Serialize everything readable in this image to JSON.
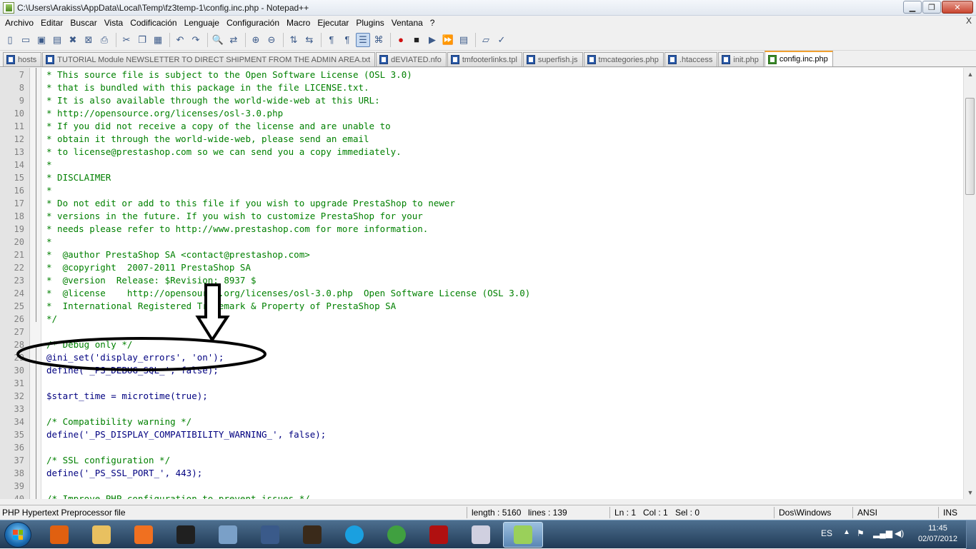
{
  "window": {
    "title": "C:\\Users\\Arakiss\\AppData\\Local\\Temp\\fz3temp-1\\config.inc.php - Notepad++",
    "minimize_glyph": "▁",
    "maximize_glyph": "❐",
    "close_glyph": "✕"
  },
  "menu": {
    "items": [
      "Archivo",
      "Editar",
      "Buscar",
      "Vista",
      "Codificación",
      "Lenguaje",
      "Configuración",
      "Macro",
      "Ejecutar",
      "Plugins",
      "Ventana",
      "?"
    ],
    "close_glyph": "X"
  },
  "toolbar": {
    "icons": [
      "new-file-icon",
      "open-file-icon",
      "save-icon",
      "save-all-icon",
      "close-icon",
      "close-all-icon",
      "print-icon",
      "cut-icon",
      "copy-icon",
      "paste-icon",
      "undo-icon",
      "redo-icon",
      "find-icon",
      "replace-icon",
      "zoom-in-icon",
      "zoom-out-icon",
      "sync-vertical-icon",
      "sync-horizontal-icon",
      "word-wrap-icon",
      "all-characters-icon",
      "indent-guide-icon",
      "user-language-icon",
      "record-macro-icon",
      "stop-record-icon",
      "play-macro-icon",
      "run-macro-multiple-icon",
      "save-macro-icon",
      "folder-icon",
      "spell-check-icon"
    ]
  },
  "tabs": [
    {
      "label": "hosts",
      "active": false
    },
    {
      "label": "TUTORIAL Module NEWSLETTER TO DIRECT SHIPMENT FROM THE ADMIN AREA.txt",
      "active": false
    },
    {
      "label": "dEVIATED.nfo",
      "active": false
    },
    {
      "label": "tmfooterlinks.tpl",
      "active": false
    },
    {
      "label": "superfish.js",
      "active": false
    },
    {
      "label": "tmcategories.php",
      "active": false
    },
    {
      "label": ".htaccess",
      "active": false
    },
    {
      "label": "init.php",
      "active": false
    },
    {
      "label": "config.inc.php",
      "active": true
    }
  ],
  "editor": {
    "lines": [
      {
        "n": "7",
        "text": "* This source file is subject to the Open Software License (OSL 3.0)",
        "kind": "comment"
      },
      {
        "n": "8",
        "text": "* that is bundled with this package in the file LICENSE.txt.",
        "kind": "comment"
      },
      {
        "n": "9",
        "text": "* It is also available through the world-wide-web at this URL:",
        "kind": "comment"
      },
      {
        "n": "10",
        "text": "* http://opensource.org/licenses/osl-3.0.php",
        "kind": "comment"
      },
      {
        "n": "11",
        "text": "* If you did not receive a copy of the license and are unable to",
        "kind": "comment"
      },
      {
        "n": "12",
        "text": "* obtain it through the world-wide-web, please send an email",
        "kind": "comment"
      },
      {
        "n": "13",
        "text": "* to license@prestashop.com so we can send you a copy immediately.",
        "kind": "comment"
      },
      {
        "n": "14",
        "text": "*",
        "kind": "comment"
      },
      {
        "n": "15",
        "text": "* DISCLAIMER",
        "kind": "comment"
      },
      {
        "n": "16",
        "text": "*",
        "kind": "comment"
      },
      {
        "n": "17",
        "text": "* Do not edit or add to this file if you wish to upgrade PrestaShop to newer",
        "kind": "comment"
      },
      {
        "n": "18",
        "text": "* versions in the future. If you wish to customize PrestaShop for your",
        "kind": "comment"
      },
      {
        "n": "19",
        "text": "* needs please refer to http://www.prestashop.com for more information.",
        "kind": "comment"
      },
      {
        "n": "20",
        "text": "*",
        "kind": "comment"
      },
      {
        "n": "21",
        "text": "*  @author PrestaShop SA <contact@prestashop.com>",
        "kind": "comment"
      },
      {
        "n": "22",
        "text": "*  @copyright  2007-2011 PrestaShop SA",
        "kind": "comment"
      },
      {
        "n": "23",
        "text": "*  @version  Release: $Revision: 8937 $",
        "kind": "comment"
      },
      {
        "n": "24",
        "text": "*  @license    http://opensource.org/licenses/osl-3.0.php  Open Software License (OSL 3.0)",
        "kind": "comment"
      },
      {
        "n": "25",
        "text": "*  International Registered Trademark & Property of PrestaShop SA",
        "kind": "comment"
      },
      {
        "n": "26",
        "text": "*/",
        "kind": "comment"
      },
      {
        "n": "27",
        "text": "",
        "kind": "blank"
      },
      {
        "n": "28",
        "text": "/* Debug only */",
        "kind": "comment"
      },
      {
        "n": "29",
        "text": "@ini_set('display_errors', 'on');",
        "kind": "php"
      },
      {
        "n": "30",
        "text": "define('_PS_DEBUG_SQL_', false);",
        "kind": "php"
      },
      {
        "n": "31",
        "text": "",
        "kind": "blank"
      },
      {
        "n": "32",
        "text": "$start_time = microtime(true);",
        "kind": "php"
      },
      {
        "n": "33",
        "text": "",
        "kind": "blank"
      },
      {
        "n": "34",
        "text": "/* Compatibility warning */",
        "kind": "comment"
      },
      {
        "n": "35",
        "text": "define('_PS_DISPLAY_COMPATIBILITY_WARNING_', false);",
        "kind": "php"
      },
      {
        "n": "36",
        "text": "",
        "kind": "blank"
      },
      {
        "n": "37",
        "text": "/* SSL configuration */",
        "kind": "comment"
      },
      {
        "n": "38",
        "text": "define('_PS_SSL_PORT_', 443);",
        "kind": "php"
      },
      {
        "n": "39",
        "text": "",
        "kind": "blank"
      },
      {
        "n": "40",
        "text": "/* Improve PHP configuration to prevent issues */",
        "kind": "comment"
      }
    ]
  },
  "status": {
    "file_type": "PHP Hypertext Preprocessor file",
    "length": "length : 5160",
    "lines": "lines : 139",
    "ln": "Ln : 1",
    "col": "Col : 1",
    "sel": "Sel : 0",
    "eol": "Dos\\Windows",
    "encoding": "ANSI",
    "mode": "INS"
  },
  "taskbar": {
    "apps": [
      "media-player-icon",
      "explorer-folder-icon",
      "office-icon",
      "need-for-speed-icon",
      "calculator-icon",
      "unknown-app-icon",
      "diablo-icon",
      "skype-icon",
      "chrome-icon",
      "filezilla-icon",
      "paint-icon",
      "notepad-plus-plus-icon"
    ],
    "language": "ES",
    "time": "11:45",
    "date": "02/07/2012"
  },
  "colors": {
    "comment": "#008000",
    "code": "#000080",
    "annotation": "#000000"
  }
}
